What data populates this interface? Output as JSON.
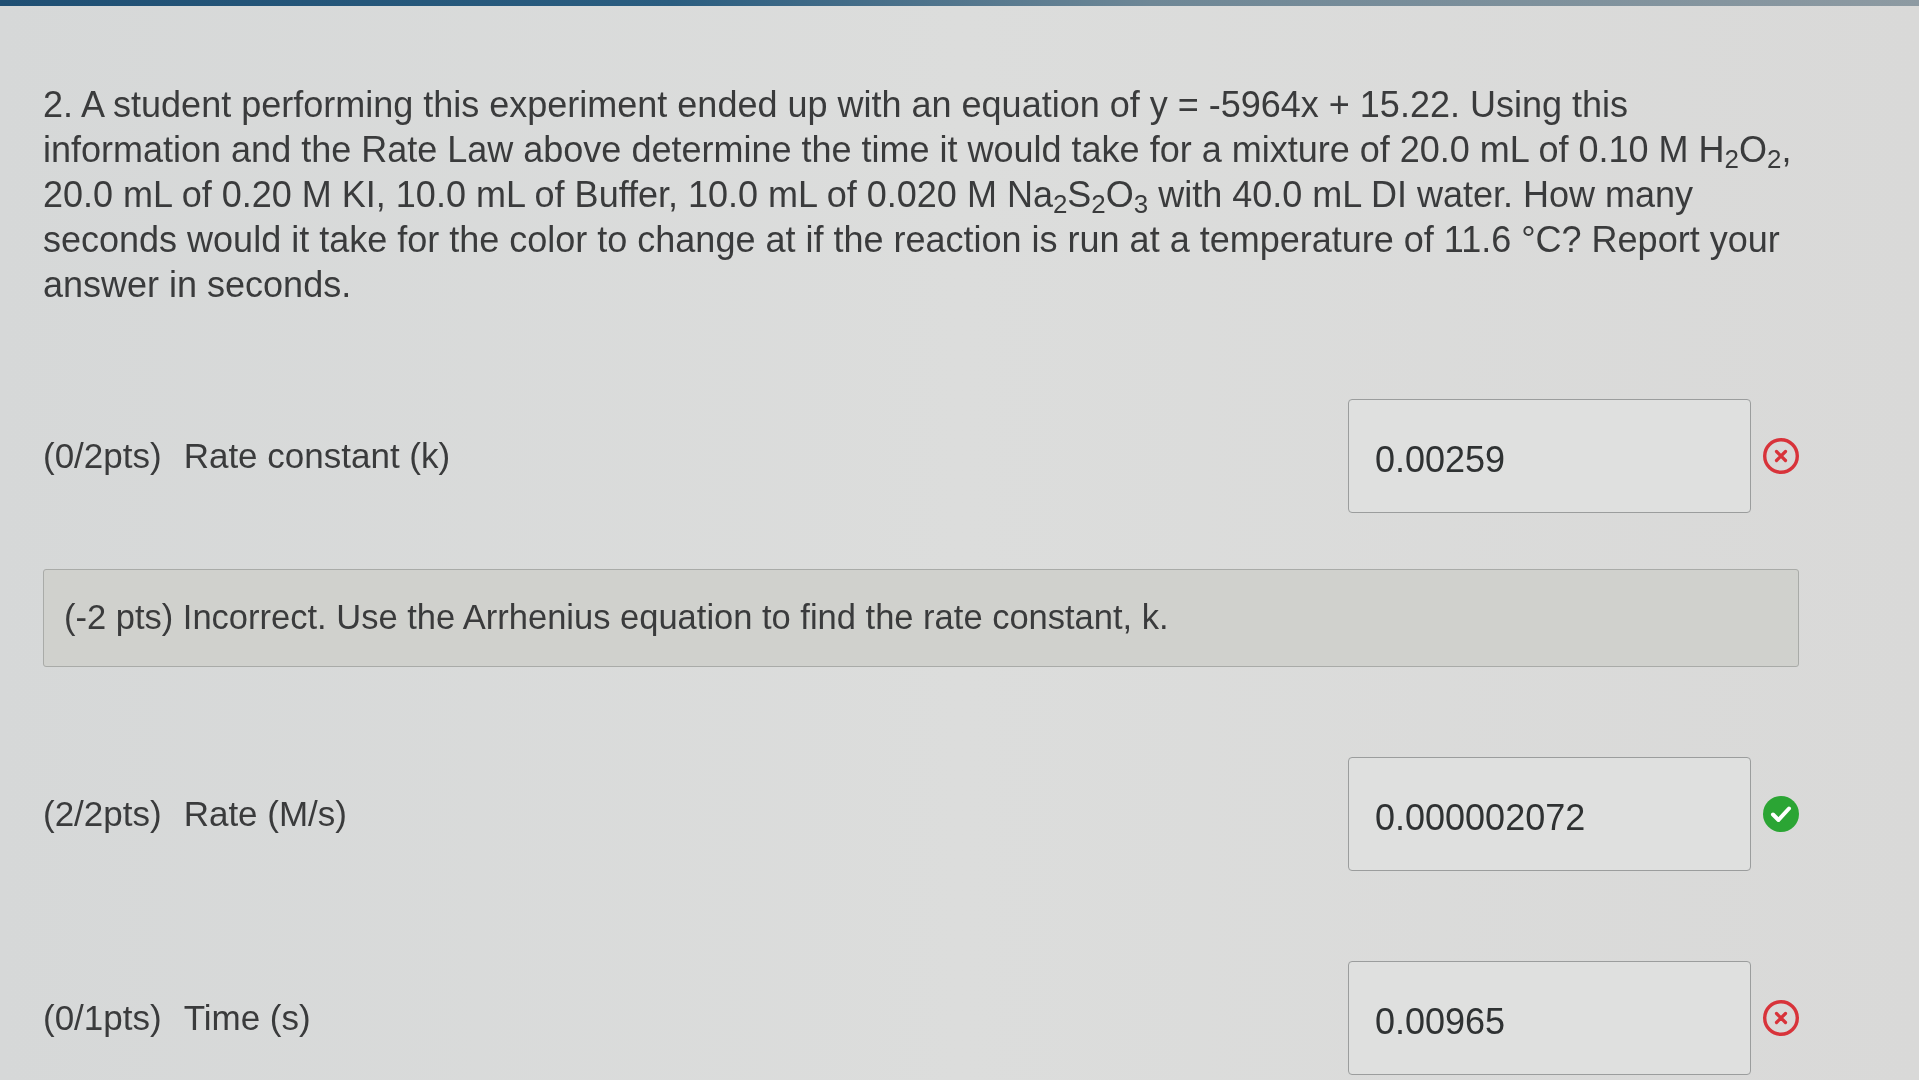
{
  "question": {
    "text": "2. A student performing this experiment ended up with an equation of y = -5964x + 15.22. Using this information and the Rate Law above determine the time it would take for a mixture of 20.0 mL of 0.10 M H$_{2}$O$_{2}$, 20.0 mL of 0.20 M KI, 10.0 mL of Buffer, 10.0 mL of 0.020 M Na$_{2}$S$_{2}$O$_{3}$ with 40.0 mL DI water. How many seconds would it take for the color to change at if the reaction is run at a temperature of 11.6 °C? Report your answer in seconds."
  },
  "parts": [
    {
      "score": "(0/2pts)",
      "label": "Rate constant (k)",
      "value": "0.00259",
      "correct": false,
      "feedback": "(-2 pts) Incorrect. Use the Arrhenius equation to find the rate constant, k."
    },
    {
      "score": "(2/2pts)",
      "label": "Rate (M/s)",
      "value": "0.000002072",
      "correct": true
    },
    {
      "score": "(0/1pts)",
      "label": "Time (s)",
      "value": "0.00965",
      "correct": false
    }
  ]
}
